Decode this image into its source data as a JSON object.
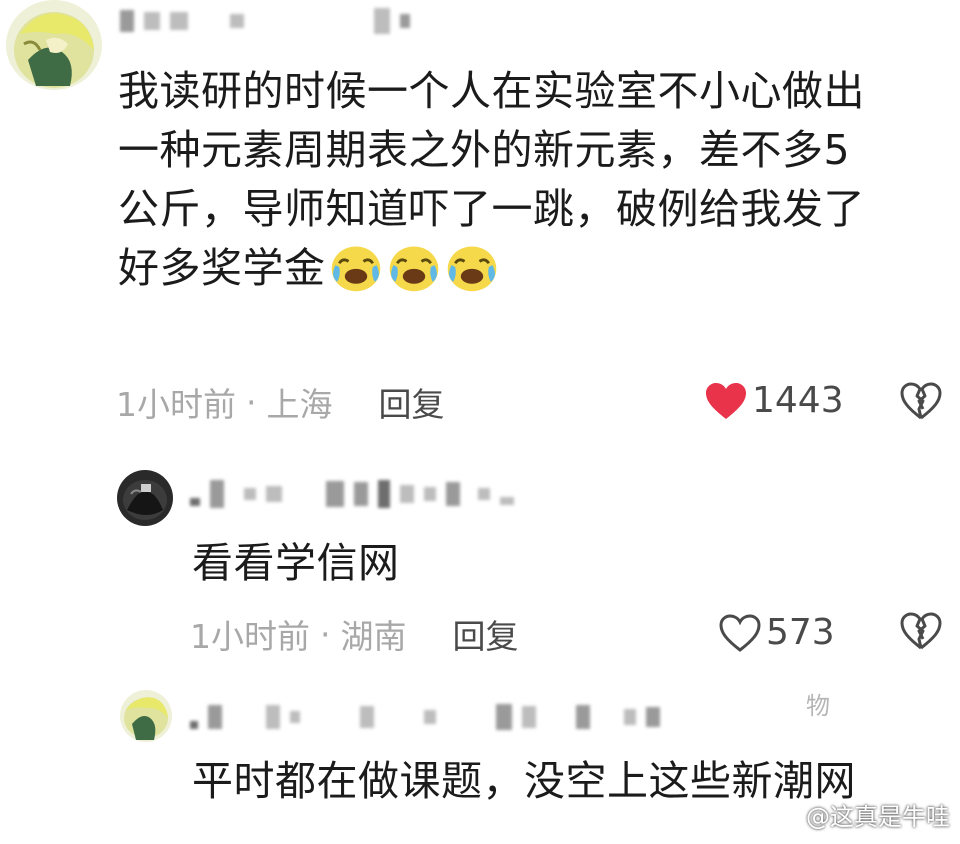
{
  "comments": [
    {
      "body_lines": [
        "我读研的时候一个人在实验室不小心做出",
        "一种元素周期表之外的新元素，差不多5",
        "公斤，导师知道吓了一跳，破例给我发了",
        "好多奖学金"
      ],
      "emoji_icons": [
        "crying-laughing-emoji",
        "crying-laughing-emoji",
        "crying-laughing-emoji"
      ],
      "time": "1小时前",
      "location": "上海",
      "reply_label": "回复",
      "likes": "1443",
      "liked": true
    },
    {
      "body": "看看学信网",
      "time": "1小时前",
      "location": "湖南",
      "reply_label": "回复",
      "likes": "573",
      "liked": false
    },
    {
      "body": "平时都在做课题，没空上这些新潮网",
      "side_fragment": "物"
    }
  ],
  "separator": "·",
  "watermark": {
    "icon": "weibo-logo-icon",
    "text": "@这真是牛哇"
  },
  "colors": {
    "like_active": "#e8334a",
    "meta_gray": "#a8a8a8",
    "text": "#1b1b1b"
  }
}
